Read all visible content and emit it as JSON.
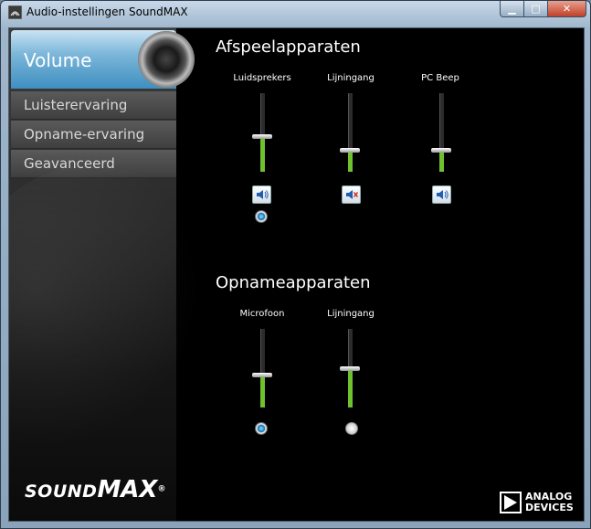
{
  "window": {
    "title": "Audio-instellingen SoundMAX"
  },
  "sidebar": {
    "active": "Volume",
    "items": [
      "Luisterervaring",
      "Opname-ervaring",
      "Geavanceerd"
    ]
  },
  "branding": {
    "soundmax_part1": "SOUND",
    "soundmax_part2": "MAX",
    "reg_mark": "®",
    "vendor_line1": "ANALOG",
    "vendor_line2": "DEVICES"
  },
  "playback": {
    "title": "Afspeelapparaten",
    "devices": [
      {
        "label": "Luidsprekers",
        "level": 0.45,
        "muted": false,
        "default": true
      },
      {
        "label": "Lijningang",
        "level": 0.28,
        "muted": true,
        "default": null
      },
      {
        "label": "PC Beep",
        "level": 0.28,
        "muted": false,
        "default": null
      }
    ]
  },
  "recording": {
    "title": "Opnameapparaten",
    "devices": [
      {
        "label": "Microfoon",
        "level": 0.42,
        "default": true
      },
      {
        "label": "Lijningang",
        "level": 0.5,
        "default": false
      }
    ]
  },
  "icons": {
    "speaker": "speaker-icon",
    "speaker_muted": "speaker-muted-icon"
  },
  "colors": {
    "accent": "#3e8fc0",
    "level_fill": "#6fc12e"
  }
}
